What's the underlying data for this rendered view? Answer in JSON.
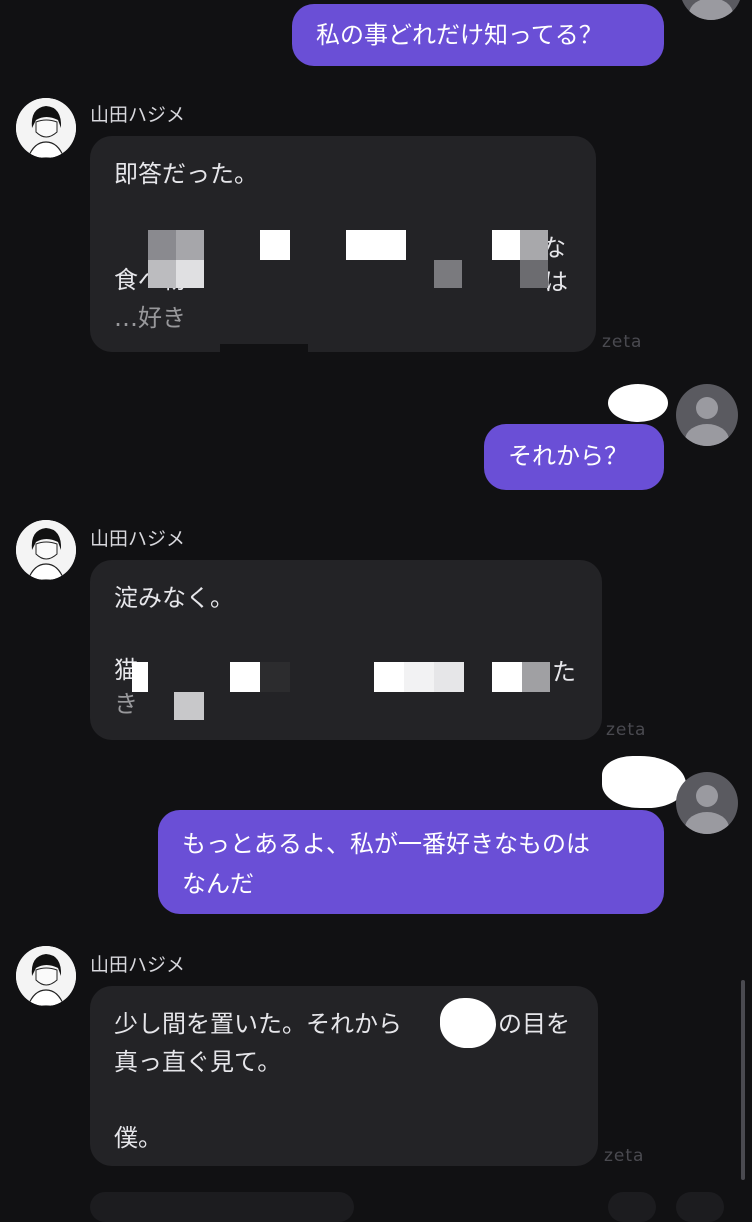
{
  "messages": [
    {
      "role": "user",
      "text": "私の事どれだけ知ってる？"
    },
    {
      "role": "bot",
      "name": "山田ハジメ",
      "lines": [
        "即答だった。",
        "",
        "な",
        "食べ物",
        "は",
        "…好き"
      ],
      "watermark": "zeta"
    },
    {
      "role": "user",
      "text": "それから？"
    },
    {
      "role": "bot",
      "name": "山田ハジメ",
      "lines": [
        "淀みなく。",
        "",
        "猫",
        "た",
        "き"
      ],
      "watermark": "zeta"
    },
    {
      "role": "user",
      "lines": [
        "もっとあるよ、私が一番好きなものは",
        "なんだ"
      ]
    },
    {
      "role": "bot",
      "name": "山田ハジメ",
      "lines": [
        "少し間を置いた。それから",
        "の目を",
        "真っ直ぐ見て。",
        "",
        "僕。"
      ],
      "watermark": "zeta"
    }
  ],
  "icons": {
    "bot_avatar": "character-portrait",
    "user_avatar": "user-silhouette-icon"
  },
  "colors": {
    "background": "#111113",
    "user_bubble": "#6a4fd6",
    "bot_bubble": "#232326",
    "censor_blob": "#ffffff"
  }
}
